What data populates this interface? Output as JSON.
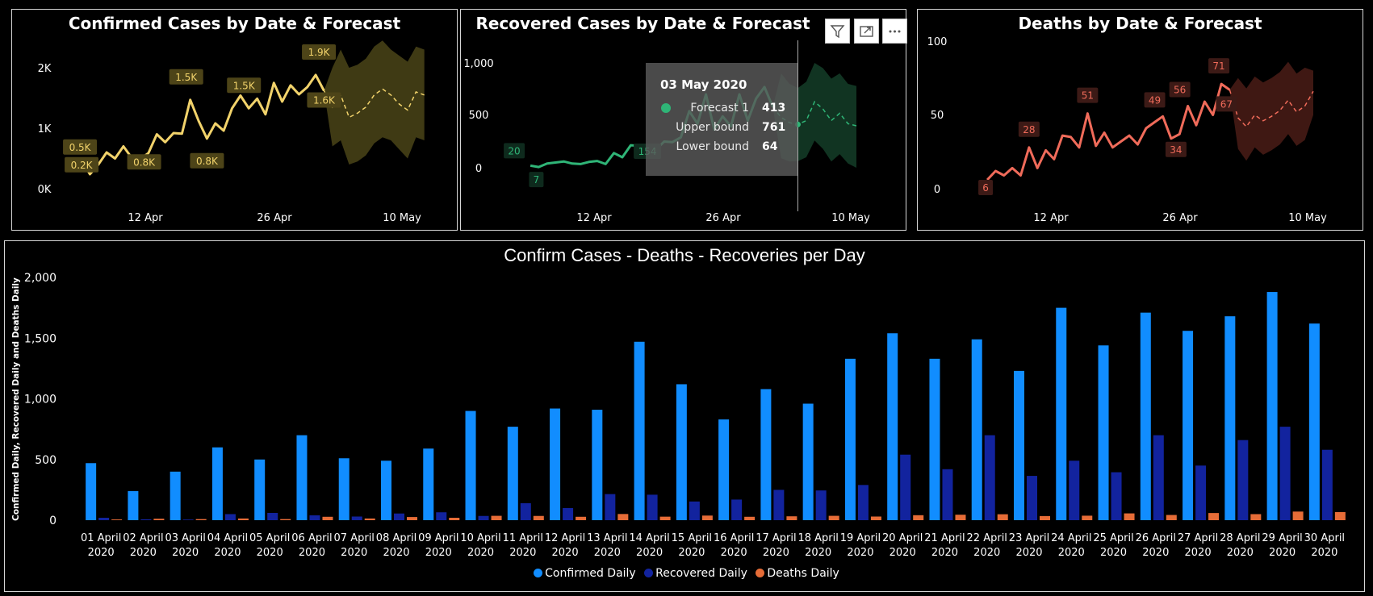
{
  "colors": {
    "confirmed_line": "#f2d36b",
    "recovered_line": "#2fb577",
    "deaths_line": "#f06b5a",
    "confirmed_bar": "#118dff",
    "recovered_bar": "#12239e",
    "deaths_bar": "#e66c37"
  },
  "header_icons": [
    "filter-icon",
    "focus-mode-icon",
    "more-options-icon"
  ],
  "chart_data": [
    {
      "type": "line",
      "title": "Confirmed Cases by Date & Forecast",
      "y_ticks": [
        "0K",
        "1K",
        "2K"
      ],
      "x_ticks": [
        "12 Apr",
        "26 Apr",
        "10 May"
      ],
      "ylim": [
        0,
        2200
      ],
      "x_range": [
        "29 Mar",
        "10 May"
      ],
      "series": [
        {
          "values_x_start": "01 Apr",
          "values": [
            470,
            240,
            400,
            600,
            500,
            700,
            510,
            490,
            590,
            900,
            770,
            920,
            910,
            1470,
            1120,
            830,
            1080,
            960,
            1330,
            1540,
            1330,
            1490,
            1230,
            1750,
            1440,
            1710,
            1560,
            1680,
            1880,
            1620
          ]
        }
      ],
      "forecast": {
        "start": "30 Apr",
        "values": [
          1620,
          1350,
          1550,
          1180,
          1250,
          1350,
          1550,
          1650,
          1550,
          1400,
          1300,
          1600,
          1550
        ],
        "upper": [
          1620,
          2000,
          2300,
          2000,
          2050,
          2150,
          2350,
          2450,
          2300,
          2200,
          2100,
          2350,
          2300
        ],
        "lower": [
          1620,
          700,
          800,
          400,
          450,
          550,
          750,
          850,
          800,
          650,
          500,
          850,
          800
        ]
      },
      "data_labels": [
        "0.5K",
        "0.2K",
        "0.8K",
        "1.5K",
        "0.8K",
        "1.5K",
        "1.9K",
        "1.6K"
      ]
    },
    {
      "type": "line",
      "title": "Recovered Cases by Date & Forecast",
      "y_ticks": [
        "0",
        "500",
        "1,000"
      ],
      "x_ticks": [
        "12 Apr",
        "26 Apr",
        "10 May"
      ],
      "ylim": [
        -150,
        1150
      ],
      "series": [
        {
          "values_x_start": "01 Apr",
          "values": [
            20,
            7,
            40,
            50,
            60,
            40,
            35,
            55,
            65,
            35,
            140,
            100,
            215,
            210,
            154,
            170,
            250,
            245,
            290,
            540,
            420,
            700,
            365,
            490,
            395,
            700,
            450,
            660,
            770,
            580
          ]
        }
      ],
      "forecast": {
        "start": "30 Apr",
        "values": [
          580,
          480,
          430,
          413,
          450,
          630,
          560,
          450,
          520,
          420,
          400
        ],
        "upper": [
          580,
          900,
          800,
          761,
          820,
          1000,
          950,
          850,
          900,
          800,
          780
        ],
        "lower": [
          580,
          90,
          60,
          64,
          100,
          260,
          180,
          60,
          130,
          40,
          0
        ]
      },
      "data_labels": [
        "20",
        "7",
        "154"
      ],
      "tooltip": {
        "date": "03 May 2020",
        "rows": [
          {
            "label": "Forecast 1",
            "value": "413"
          },
          {
            "label": "Upper bound",
            "value": "761"
          },
          {
            "label": "Lower bound",
            "value": "64"
          }
        ]
      }
    },
    {
      "type": "line",
      "title": "Deaths by Date & Forecast",
      "y_ticks": [
        "0",
        "50",
        "100"
      ],
      "x_ticks": [
        "12 Apr",
        "26 Apr",
        "10 May"
      ],
      "ylim": [
        0,
        105
      ],
      "series": [
        {
          "values_x_start": "01 Apr",
          "values": [
            6,
            12,
            9,
            14,
            9,
            28,
            14,
            26,
            20,
            36,
            35,
            28,
            51,
            29,
            38,
            28,
            32,
            36,
            30,
            41,
            45,
            49,
            34,
            37,
            56,
            43,
            59,
            50,
            71,
            67
          ]
        }
      ],
      "forecast": {
        "start": "30 Apr",
        "values": [
          67,
          48,
          42,
          50,
          46,
          49,
          53,
          60,
          52,
          56,
          66
        ],
        "upper": [
          67,
          75,
          68,
          76,
          72,
          75,
          79,
          86,
          78,
          82,
          80
        ],
        "lower": [
          67,
          27,
          19,
          28,
          23,
          26,
          30,
          37,
          29,
          33,
          50
        ]
      },
      "data_labels": [
        "6",
        "28",
        "51",
        "49",
        "34",
        "56",
        "71",
        "67"
      ]
    },
    {
      "type": "bar",
      "title": "Confirm Cases - Deaths - Recoveries per Day",
      "ylabel": "Confirmed Daily, Recovered Daily and Deaths Daily",
      "y_ticks": [
        "0",
        "500",
        "1,000",
        "1,500",
        "2,000"
      ],
      "ylim": [
        0,
        2000
      ],
      "categories": [
        "01 April 2020",
        "02 April 2020",
        "03 April 2020",
        "04 April 2020",
        "05 April 2020",
        "06 April 2020",
        "07 April 2020",
        "08 April 2020",
        "09 April 2020",
        "10 April 2020",
        "11 April 2020",
        "12 April 2020",
        "13 April 2020",
        "14 April 2020",
        "15 April 2020",
        "16 April 2020",
        "17 April 2020",
        "18 April 2020",
        "19 April 2020",
        "20 April 2020",
        "21 April 2020",
        "22 April 2020",
        "23 April 2020",
        "24 April 2020",
        "25 April 2020",
        "26 April 2020",
        "27 April 2020",
        "28 April 2020",
        "29 April 2020",
        "30 April 2020"
      ],
      "series": [
        {
          "name": "Confirmed Daily",
          "values": [
            470,
            240,
            400,
            600,
            500,
            700,
            510,
            490,
            590,
            900,
            770,
            920,
            910,
            1470,
            1120,
            830,
            1080,
            960,
            1330,
            1540,
            1330,
            1490,
            1230,
            1750,
            1440,
            1710,
            1560,
            1680,
            1880,
            1620
          ]
        },
        {
          "name": "Recovered Daily",
          "values": [
            20,
            7,
            5,
            50,
            60,
            40,
            30,
            55,
            65,
            35,
            140,
            100,
            215,
            210,
            154,
            170,
            250,
            245,
            290,
            540,
            420,
            700,
            365,
            490,
            395,
            700,
            450,
            660,
            770,
            580
          ]
        },
        {
          "name": "Deaths Daily",
          "values": [
            6,
            12,
            9,
            14,
            9,
            28,
            14,
            26,
            20,
            36,
            35,
            28,
            51,
            29,
            38,
            28,
            32,
            36,
            30,
            41,
            45,
            49,
            34,
            37,
            56,
            43,
            59,
            50,
            71,
            67
          ]
        }
      ],
      "legend": [
        "Confirmed Daily",
        "Recovered Daily",
        "Deaths Daily"
      ]
    }
  ]
}
